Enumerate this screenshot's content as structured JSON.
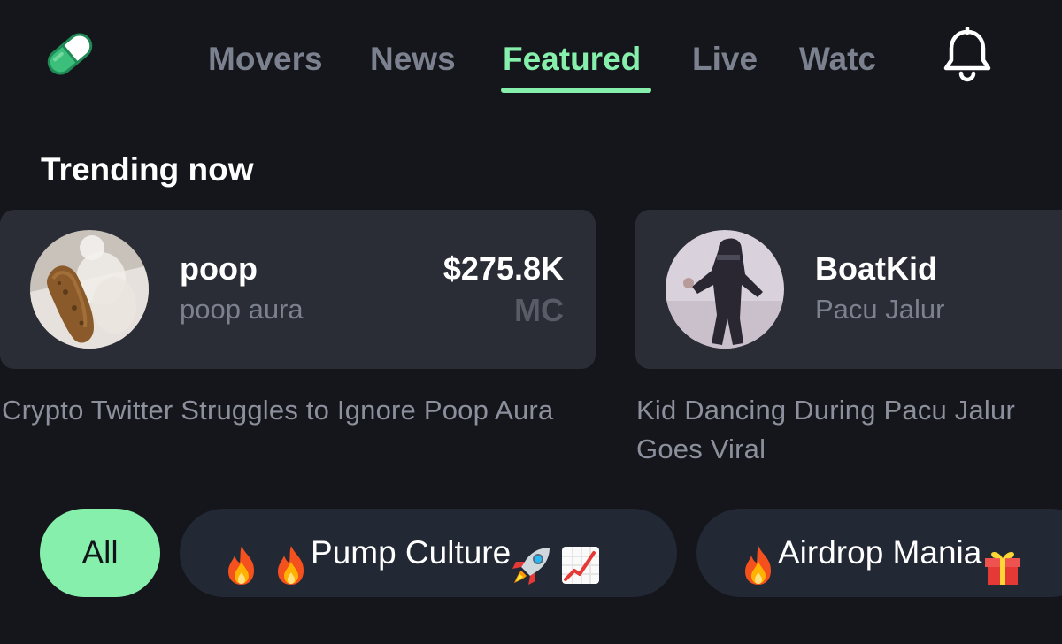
{
  "nav": {
    "tabs": [
      {
        "label": "Movers",
        "active": false
      },
      {
        "label": "News",
        "active": false
      },
      {
        "label": "Featured",
        "active": true
      },
      {
        "label": "Live",
        "active": false
      },
      {
        "label": "Watchlist",
        "active": false
      }
    ],
    "logo_icon": "pill-capsule-icon",
    "notifications_icon": "bell-icon"
  },
  "trending": {
    "title": "Trending now",
    "cards": [
      {
        "name": "poop",
        "subtitle": "poop aura",
        "market_cap": "$275.8K",
        "market_cap_label": "MC",
        "description": "Crypto Twitter Struggles to Ignore Poop Aura"
      },
      {
        "name": "BoatKid",
        "subtitle": "Pacu Jalur",
        "description": "Kid Dancing During Pacu Jalur Goes Viral"
      }
    ]
  },
  "filters": [
    {
      "label": "All",
      "active": true
    },
    {
      "label": "Pump Culture",
      "emoji_before": [
        "fire",
        "fire"
      ],
      "emoji_after": [
        "rocket",
        "chart-increasing"
      ]
    },
    {
      "label": "Airdrop Mania",
      "emoji_before": [
        "fire"
      ],
      "emoji_after": [
        "gift"
      ]
    }
  ],
  "colors": {
    "background": "#15161b",
    "accent": "#86efac",
    "card": "#2b2d36",
    "chip": "#232835",
    "muted_text": "#7b818e"
  }
}
